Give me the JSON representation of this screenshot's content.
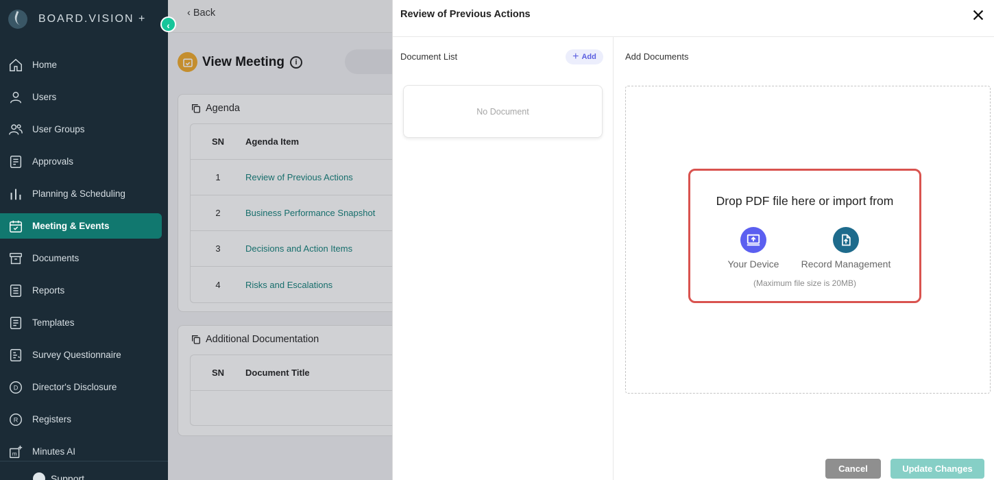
{
  "app": {
    "brand": "BOARD.VISION +",
    "collapse_icon": "chevron-left-icon"
  },
  "sidebar": {
    "items": [
      {
        "label": "Home",
        "icon": "home-icon"
      },
      {
        "label": "Users",
        "icon": "user-icon"
      },
      {
        "label": "User Groups",
        "icon": "user-group-icon"
      },
      {
        "label": "Approvals",
        "icon": "approval-icon"
      },
      {
        "label": "Planning & Scheduling",
        "icon": "bar-chart-icon"
      },
      {
        "label": "Meeting & Events",
        "icon": "calendar-check-icon",
        "active": true
      },
      {
        "label": "Documents",
        "icon": "archive-icon"
      },
      {
        "label": "Reports",
        "icon": "list-icon"
      },
      {
        "label": "Templates",
        "icon": "template-icon"
      },
      {
        "label": "Survey Questionnaire",
        "icon": "survey-icon"
      },
      {
        "label": "Director's Disclosure",
        "icon": "letter-d-icon"
      },
      {
        "label": "Registers",
        "icon": "letter-r-icon"
      },
      {
        "label": "Minutes AI",
        "icon": "minutes-ai-icon"
      }
    ],
    "support_label": "Support"
  },
  "main": {
    "back_label": "Back",
    "page_title": "View Meeting",
    "agenda": {
      "title": "Agenda",
      "headers": {
        "sn": "SN",
        "item": "Agenda Item"
      },
      "rows": [
        {
          "sn": "1",
          "item": "Review of Previous Actions"
        },
        {
          "sn": "2",
          "item": "Business Performance Snapshot"
        },
        {
          "sn": "3",
          "item": "Decisions and Action Items"
        },
        {
          "sn": "4",
          "item": "Risks and Escalations"
        }
      ]
    },
    "additional": {
      "title": "Additional Documentation",
      "headers": {
        "sn": "SN",
        "title": "Document Title"
      }
    }
  },
  "panel": {
    "title": "Review of Previous Actions",
    "document_list_label": "Document List",
    "add_label": "Add",
    "no_document": "No Document",
    "add_documents_label": "Add Documents",
    "drop_text": "Drop PDF file here or import from",
    "sources": [
      {
        "label": "Your Device",
        "icon": "device-upload-icon",
        "color": "#5b5ff0"
      },
      {
        "label": "Record Management",
        "icon": "file-upload-icon",
        "color": "#1e6b8c"
      }
    ],
    "max_size": "(Maximum file size is 20MB)",
    "cancel_label": "Cancel",
    "update_label": "Update Changes"
  },
  "colors": {
    "sidebar_bg": "#1b2b36",
    "active_item": "#11786f",
    "accent_green": "#16c59a",
    "highlight_border": "#d9534f",
    "link": "#12807a"
  }
}
